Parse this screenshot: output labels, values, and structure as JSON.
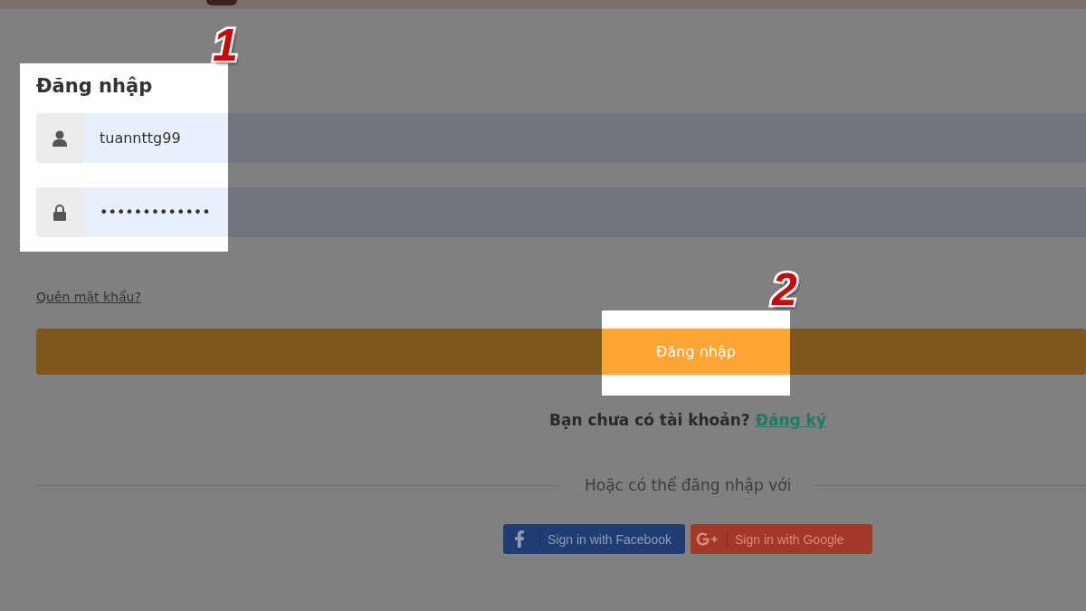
{
  "annotations": [
    {
      "text": "1"
    },
    {
      "text": "2"
    }
  ],
  "login": {
    "title": "Đăng nhập",
    "username": {
      "value": "tuannttg99"
    },
    "password": {
      "value": "•••••••••••••"
    },
    "forgot_link": "Quên mật khẩu?",
    "submit_button": "Đăng nhập",
    "register": {
      "prompt": "Bạn chưa có tài khoản?",
      "link": "Đăng ký"
    },
    "divider_text": "Hoặc có thể đăng nhập với",
    "social_buttons": [
      {
        "kind": "facebook",
        "label": "Sign in with Facebook"
      },
      {
        "kind": "google",
        "label": "Sign in with Google"
      }
    ]
  }
}
